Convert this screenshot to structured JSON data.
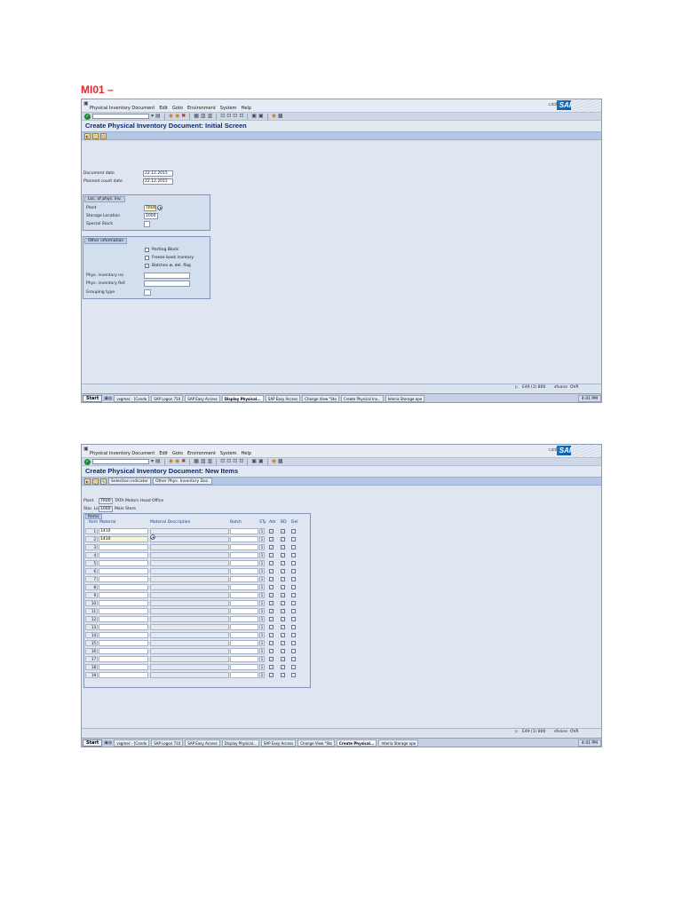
{
  "heading": "MI01 –",
  "common": {
    "menu": [
      "Physical Inventory Document",
      "Edit",
      "Goto",
      "Environment",
      "System",
      "Help"
    ],
    "sap_logo": "SAP",
    "status": {
      "session": "E49 (1) 800",
      "server": "sfvone",
      "mode": "OVR"
    },
    "taskbar": {
      "start": "Start",
      "clock": "4:41 PM",
      "tasks": [
        "vsgmec - [Condo",
        "SAP Logon 710",
        "SAP Easy Access",
        "Display Physical...",
        "SAP Easy Access",
        "Change View \"Sto",
        "Create Physical Inv...",
        "Interia Storage ope"
      ]
    }
  },
  "screen1": {
    "title": "Create Physical Inventory Document: Initial Screen",
    "fields": {
      "document_date_label": "Document date",
      "document_date": "22.12.2015",
      "planned_count_date_label": "Planned count date",
      "planned_count_date": "22.12.2015"
    },
    "loc_group": {
      "title": "Loc. of phys. inv.",
      "plant_label": "Plant",
      "plant": "TR00",
      "sloc_label": "Storage Location",
      "sloc": "1000",
      "special_stock_label": "Special Stock"
    },
    "other_group": {
      "title": "Other information",
      "posting_block": "Posting Block",
      "freeze_book": "Freeze book invntory",
      "batches_del_flag": "Batches w. del. flag",
      "phys_inv_no_label": "Phys. inventory no",
      "phys_inv_ref_label": "Phys. inventory Ref.",
      "grouping_type_label": "Grouping type"
    },
    "active_task": "Display Physical..."
  },
  "screen2": {
    "title": "Create Physical Inventory Document: New Items",
    "buttons": {
      "selection_indicator": "Selection indicator",
      "other_phys": "Other Phys. Inventory Doc."
    },
    "plant_label": "Plant",
    "plant_value": "TR00",
    "plant_desc": "TATA Motors Head Office",
    "sloc_label": "Stor. Loc.",
    "sloc_value": "1000",
    "sloc_desc": "Main Store",
    "items_title": "Items",
    "columns": {
      "item": "Item",
      "material": "Material",
      "desc": "Material Description",
      "batch": "Batch",
      "sty": "STy",
      "alt": "Altr",
      "bd": "BD",
      "del": "Del"
    },
    "rows": [
      {
        "num": "1",
        "material": "1410",
        "sty": "1"
      },
      {
        "num": "2",
        "material": "1410",
        "sty": "1"
      },
      {
        "num": "3",
        "material": "",
        "sty": "1"
      },
      {
        "num": "4",
        "material": "",
        "sty": "1"
      },
      {
        "num": "5",
        "material": "",
        "sty": "1"
      },
      {
        "num": "6",
        "material": "",
        "sty": "1"
      },
      {
        "num": "7",
        "material": "",
        "sty": "1"
      },
      {
        "num": "8",
        "material": "",
        "sty": "1"
      },
      {
        "num": "9",
        "material": "",
        "sty": "1"
      },
      {
        "num": "10",
        "material": "",
        "sty": "1"
      },
      {
        "num": "11",
        "material": "",
        "sty": "1"
      },
      {
        "num": "12",
        "material": "",
        "sty": "1"
      },
      {
        "num": "13",
        "material": "",
        "sty": "1"
      },
      {
        "num": "14",
        "material": "",
        "sty": "1"
      },
      {
        "num": "15",
        "material": "",
        "sty": "1"
      },
      {
        "num": "16",
        "material": "",
        "sty": "1"
      },
      {
        "num": "17",
        "material": "",
        "sty": "1"
      },
      {
        "num": "18",
        "material": "",
        "sty": "1"
      },
      {
        "num": "19",
        "material": "",
        "sty": "1"
      }
    ],
    "check_mark": "✓",
    "active_task": "Create Physical..."
  }
}
